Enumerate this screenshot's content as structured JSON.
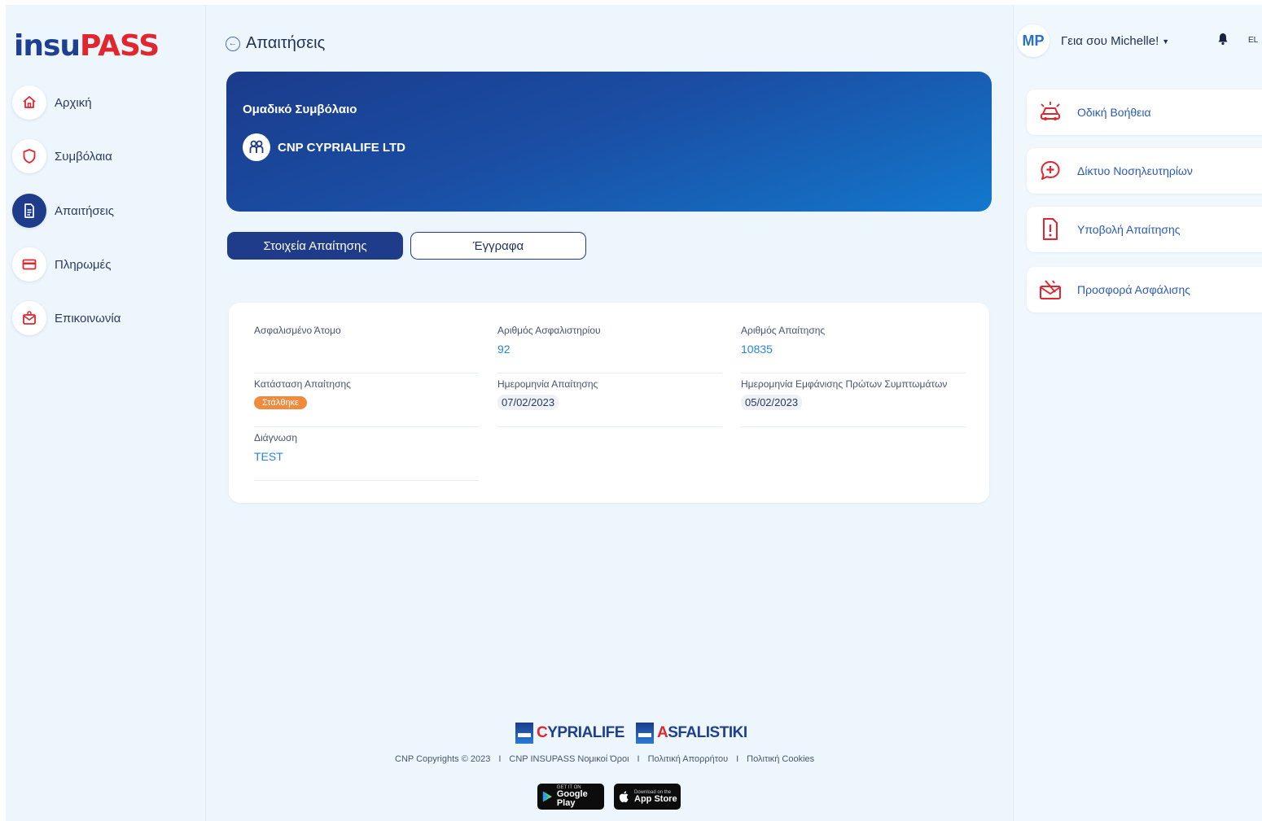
{
  "app": {
    "logo_part1": "insu",
    "logo_part2": "PASS"
  },
  "sidebar": {
    "items": [
      {
        "label": "Αρχική",
        "icon": "home-icon"
      },
      {
        "label": "Συμβόλαια",
        "icon": "shield-icon"
      },
      {
        "label": "Απαιτήσεις",
        "icon": "document-icon",
        "active": true
      },
      {
        "label": "Πληρωμές",
        "icon": "card-icon"
      },
      {
        "label": "Επικοινωνία",
        "icon": "contact-icon"
      }
    ]
  },
  "header": {
    "title": "Απαιτήσεις"
  },
  "banner": {
    "label": "Ομαδικό Συμβόλαιο",
    "company": "CNP CYPRIALIFE LTD"
  },
  "tabs": [
    {
      "label": "Στοιχεία Απαίτησης",
      "active": true
    },
    {
      "label": "Έγγραφα",
      "active": false
    }
  ],
  "claim": {
    "insured_label": "Ασφαλισμένο Άτομο",
    "insured_value": "",
    "policy_label": "Αριθμός Ασφαλιστηρίου",
    "policy_value": "92",
    "claim_no_label": "Αριθμός Απαίτησης",
    "claim_no_value": "10835",
    "status_label": "Κατάσταση Απαίτησης",
    "status_value": "Στάλθηκε",
    "claim_date_label": "Ημερομηνία Απαίτησης",
    "claim_date_value": "07/02/2023",
    "symptoms_date_label": "Ημερομηνία Εμφάνισης Πρώτων Συμπτωμάτων",
    "symptoms_date_value": "05/02/2023",
    "diagnosis_label": "Διάγνωση",
    "diagnosis_value": "TEST"
  },
  "footer": {
    "brand1_first": "C",
    "brand1_rest": "YPRIALIFE",
    "brand2_first": "A",
    "brand2_rest": "SFALISTIKI",
    "copyright": "CNP Copyrights © 2023",
    "terms": "CNP INSUPASS Νομικοί Όροι",
    "privacy": "Πολιτική Απορρήτου",
    "cookies": "Πολιτική Cookies",
    "separator": "I",
    "google_small": "GET IT ON",
    "google_big": "Google Play",
    "apple_small": "Download on the",
    "apple_big": "App Store"
  },
  "user": {
    "initials": "MP",
    "greeting": "Γεια σου Michelle!",
    "language": "EL"
  },
  "quick_actions": [
    {
      "label": "Οδική Βοήθεια",
      "icon": "roadside-car-icon"
    },
    {
      "label": "Δίκτυο Νοσηλευτηρίων",
      "icon": "hospital-network-icon"
    },
    {
      "label": "Υποβολή Απαίτησης",
      "icon": "submit-claim-icon"
    },
    {
      "label": "Προσφορά Ασφάλισης",
      "icon": "insurance-offer-icon"
    }
  ],
  "colors": {
    "primary": "#1e3c8a",
    "accent_red": "#e0262f",
    "link_blue": "#2a84d6",
    "status_orange": "#f08a3c",
    "background": "#eef6fd"
  }
}
